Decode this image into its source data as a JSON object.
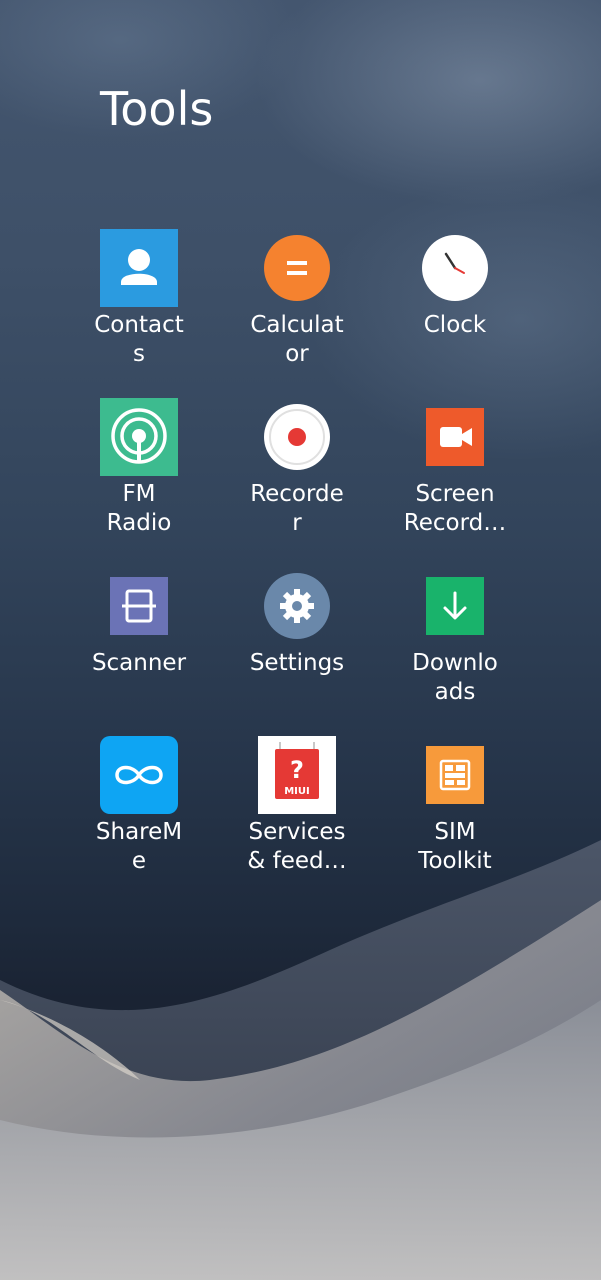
{
  "folder": {
    "title": "Tools"
  },
  "apps": [
    {
      "label": "Contact\ns",
      "icon": "contacts-icon",
      "color": "#2b9be0"
    },
    {
      "label": "Calculat\nor",
      "icon": "calculator-icon",
      "color": "#f5822f"
    },
    {
      "label": "Clock",
      "icon": "clock-icon",
      "color": "#ffffff"
    },
    {
      "label": "FM\nRadio",
      "icon": "fm-radio-icon",
      "color": "#3dbb8f"
    },
    {
      "label": "Recorde\nr",
      "icon": "recorder-icon",
      "color": "#e53935"
    },
    {
      "label": "Screen\nRecord…",
      "icon": "screen-recorder-icon",
      "color": "#ee5a2b"
    },
    {
      "label": "Scanner",
      "icon": "scanner-icon",
      "color": "#6b73b6"
    },
    {
      "label": "Settings",
      "icon": "settings-icon",
      "color": "#6a88aa"
    },
    {
      "label": "Downlo\nads",
      "icon": "downloads-icon",
      "color": "#19b36b"
    },
    {
      "label": "ShareM\ne",
      "icon": "shareme-icon",
      "color": "#0ea5f3"
    },
    {
      "label": "Services\n& feed…",
      "icon": "services-feedback-icon",
      "color": "#e53935"
    },
    {
      "label": "SIM\nToolkit",
      "icon": "sim-toolkit-icon",
      "color": "#f79a3b"
    }
  ],
  "badges": {
    "miui_text": "MIUI",
    "question_mark": "?"
  }
}
